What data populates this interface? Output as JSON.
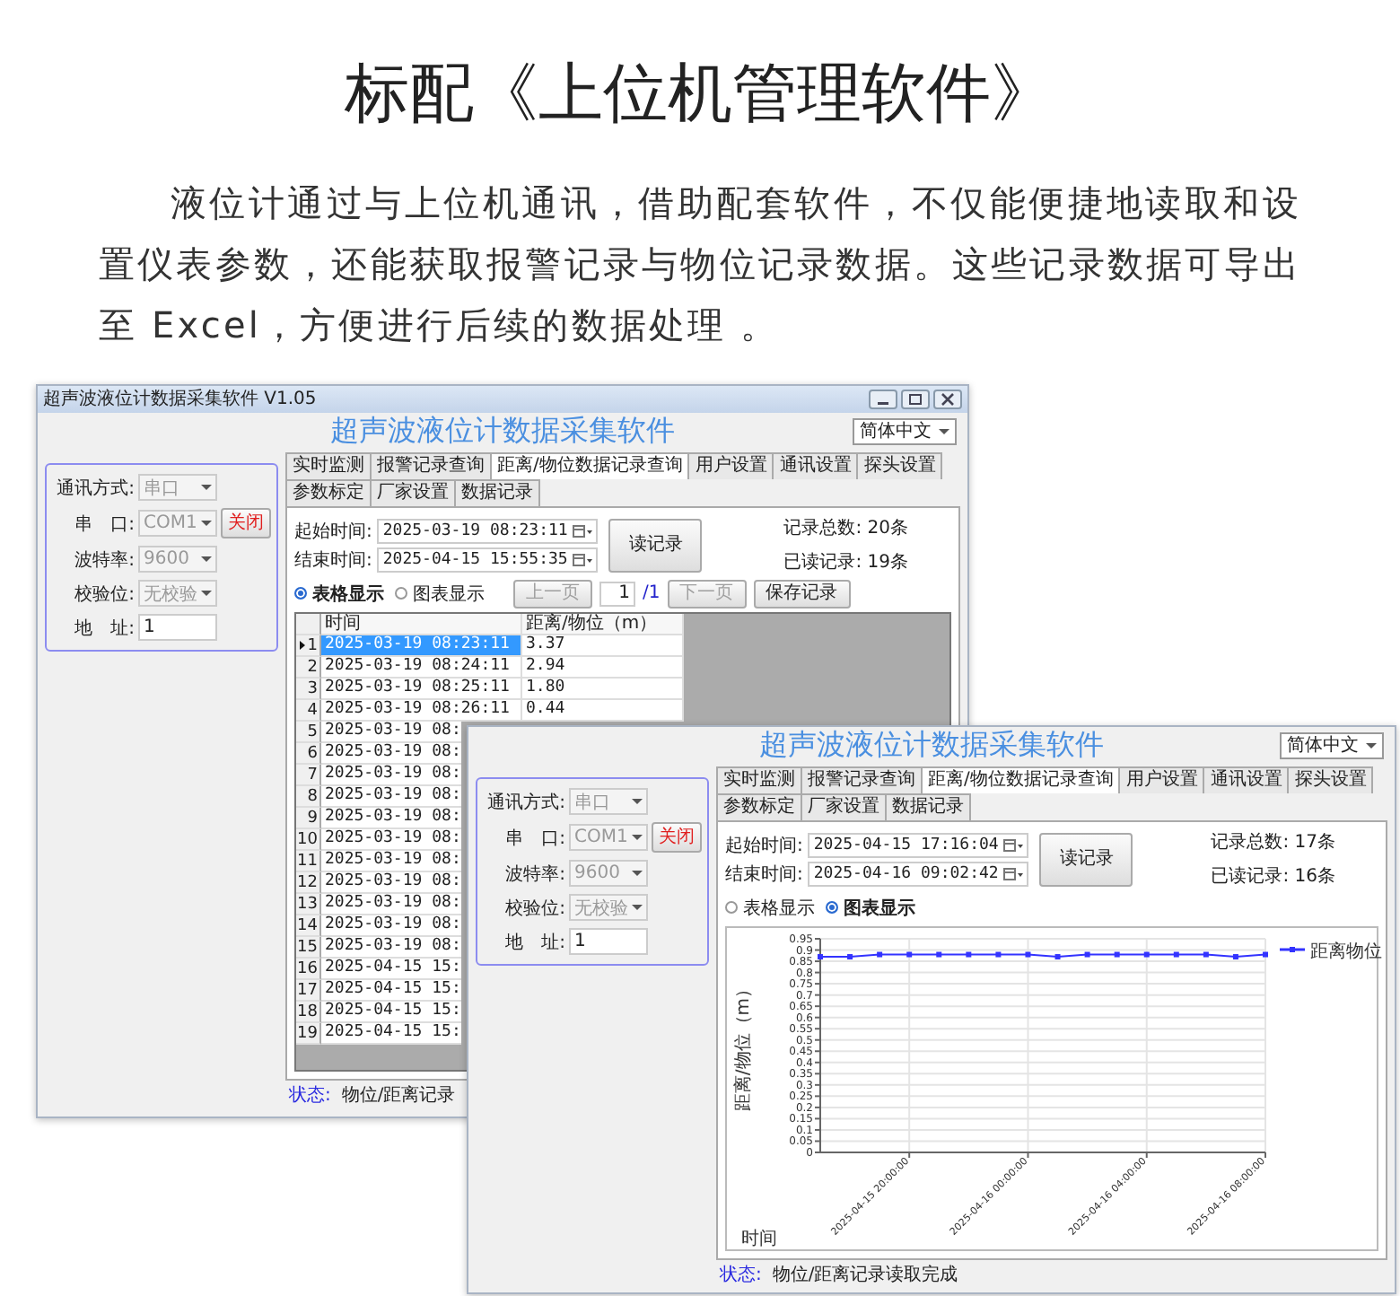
{
  "heading": "标配《上位机管理软件》",
  "intro": "液位计通过与上位机通讯，借助配套软件，不仅能便捷地读取和设置仪表参数，还能获取报警记录与物位记录数据。这些记录数据可导出至 Excel，方便进行后续的数据处理 。",
  "windows": [
    {
      "kind": "table",
      "title_bar": {
        "title": "超声波液位计数据采集软件 V1.05"
      },
      "app_title": "超声波液位计数据采集软件",
      "language": "简体中文",
      "connection": [
        {
          "label": "通讯方式:",
          "kind": "select",
          "value": "串口",
          "disabled": true
        },
        {
          "label": "串　口:",
          "kind": "select",
          "value": "COM1",
          "disabled": true,
          "button": "关闭"
        },
        {
          "label": "波特率:",
          "kind": "select",
          "value": "9600",
          "disabled": true
        },
        {
          "label": "校验位:",
          "kind": "select",
          "value": "无校验",
          "disabled": true
        },
        {
          "label": "地　址:",
          "kind": "input",
          "value": "1",
          "disabled": false
        }
      ],
      "tabs": [
        {
          "label": "实时监测",
          "selected": false
        },
        {
          "label": "报警记录查询",
          "selected": false
        },
        {
          "label": "距离/物位数据记录查询",
          "selected": true
        },
        {
          "label": "用户设置",
          "selected": false
        },
        {
          "label": "通讯设置",
          "selected": false
        },
        {
          "label": "探头设置",
          "selected": false
        },
        {
          "label": "参数标定",
          "selected": false
        },
        {
          "label": "厂家设置",
          "selected": false
        },
        {
          "label": "数据记录",
          "selected": false
        }
      ],
      "query": {
        "start_label": "起始时间:",
        "start": "2025-03-19 08:23:11",
        "end_label": "结束时间:",
        "end": "2025-04-15 15:55:35",
        "read_button": "读记录",
        "total": "记录总数: 20条",
        "read": "已读记录: 19条"
      },
      "view_options": [
        {
          "label": "表格显示",
          "selected": true
        },
        {
          "label": "图表显示",
          "selected": false
        }
      ],
      "pager": {
        "prev": {
          "label": "上一页",
          "disabled": true
        },
        "page": "1",
        "page_count": "/1",
        "next": {
          "label": "下一页",
          "disabled": true
        },
        "save": {
          "label": "保存记录",
          "disabled": false
        }
      },
      "table": {
        "columns": [
          "时间",
          "距离/物位（m）"
        ],
        "rows": [
          {
            "index": "1",
            "time": "2025-03-19 08:23:11",
            "value": "3.37",
            "selected": true
          },
          {
            "index": "2",
            "time": "2025-03-19 08:24:11",
            "value": "2.94",
            "selected": false
          },
          {
            "index": "3",
            "time": "2025-03-19 08:25:11",
            "value": "1.80",
            "selected": false
          },
          {
            "index": "4",
            "time": "2025-03-19 08:26:11",
            "value": "0.44",
            "selected": false
          },
          {
            "index": "5",
            "time": "2025-03-19 08:",
            "selected": false
          },
          {
            "index": "6",
            "time": "2025-03-19 08:",
            "selected": false
          },
          {
            "index": "7",
            "time": "2025-03-19 08:",
            "selected": false
          },
          {
            "index": "8",
            "time": "2025-03-19 08:",
            "selected": false
          },
          {
            "index": "9",
            "time": "2025-03-19 08:",
            "selected": false
          },
          {
            "index": "10",
            "time": "2025-03-19 08:",
            "selected": false
          },
          {
            "index": "11",
            "time": "2025-03-19 08:",
            "selected": false
          },
          {
            "index": "12",
            "time": "2025-03-19 08:",
            "selected": false
          },
          {
            "index": "13",
            "time": "2025-03-19 08:",
            "selected": false
          },
          {
            "index": "14",
            "time": "2025-03-19 08:",
            "selected": false
          },
          {
            "index": "15",
            "time": "2025-03-19 08:",
            "selected": false
          },
          {
            "index": "16",
            "time": "2025-04-15 15:",
            "selected": false
          },
          {
            "index": "17",
            "time": "2025-04-15 15:",
            "selected": false
          },
          {
            "index": "18",
            "time": "2025-04-15 15:",
            "selected": false
          },
          {
            "index": "19",
            "time": "2025-04-15 15:",
            "selected": false
          }
        ]
      },
      "status_label": "状态:",
      "status_text": "物位/距离记录"
    },
    {
      "kind": "chart",
      "app_title": "超声波液位计数据采集软件",
      "language": "简体中文",
      "connection": [
        {
          "label": "通讯方式:",
          "kind": "select",
          "value": "串口",
          "disabled": true
        },
        {
          "label": "串　口:",
          "kind": "select",
          "value": "COM1",
          "disabled": true,
          "button": "关闭"
        },
        {
          "label": "波特率:",
          "kind": "select",
          "value": "9600",
          "disabled": true
        },
        {
          "label": "校验位:",
          "kind": "select",
          "value": "无校验",
          "disabled": true
        },
        {
          "label": "地　址:",
          "kind": "input",
          "value": "1",
          "disabled": false
        }
      ],
      "tabs": [
        {
          "label": "实时监测",
          "selected": false
        },
        {
          "label": "报警记录查询",
          "selected": false
        },
        {
          "label": "距离/物位数据记录查询",
          "selected": true
        },
        {
          "label": "用户设置",
          "selected": false
        },
        {
          "label": "通讯设置",
          "selected": false
        },
        {
          "label": "探头设置",
          "selected": false
        },
        {
          "label": "参数标定",
          "selected": false
        },
        {
          "label": "厂家设置",
          "selected": false
        },
        {
          "label": "数据记录",
          "selected": false
        }
      ],
      "query": {
        "start_label": "起始时间:",
        "start": "2025-04-15 17:16:04",
        "end_label": "结束时间:",
        "end": "2025-04-16 09:02:42",
        "read_button": "读记录",
        "total": "记录总数: 17条",
        "read": "已读记录: 16条"
      },
      "view_options": [
        {
          "label": "表格显示",
          "selected": false
        },
        {
          "label": "图表显示",
          "selected": true
        }
      ],
      "chart_data": {
        "type": "line",
        "xlabel": "时间",
        "ylabel": "距离/物位（m）",
        "grid": true,
        "categories": [
          null,
          null,
          null,
          "2025-04-15 20:00:00",
          null,
          null,
          null,
          "2025-04-16 00:00:00",
          null,
          null,
          null,
          "2025-04-16 04:00:00",
          null,
          null,
          null,
          "2025-04-16 08:00:00"
        ],
        "ylim": [
          0,
          0.95
        ],
        "series": [
          {
            "name": "距离物位",
            "color": "#3333ff",
            "marker": "square",
            "values": [
              0.87,
              0.87,
              0.88,
              0.88,
              0.88,
              0.88,
              0.88,
              0.88,
              0.87,
              0.88,
              0.88,
              0.88,
              0.88,
              0.88,
              0.87,
              0.88
            ]
          }
        ],
        "yticks": [
          0,
          0.05,
          0.1,
          0.15,
          0.2,
          0.25,
          0.3,
          0.35,
          0.4,
          0.45,
          0.5,
          0.55,
          0.6,
          0.65,
          0.7,
          0.75,
          0.8,
          0.85,
          0.9,
          0.95
        ]
      },
      "status_label": "状态:",
      "status_text": "物位/距离记录读取完成"
    }
  ]
}
